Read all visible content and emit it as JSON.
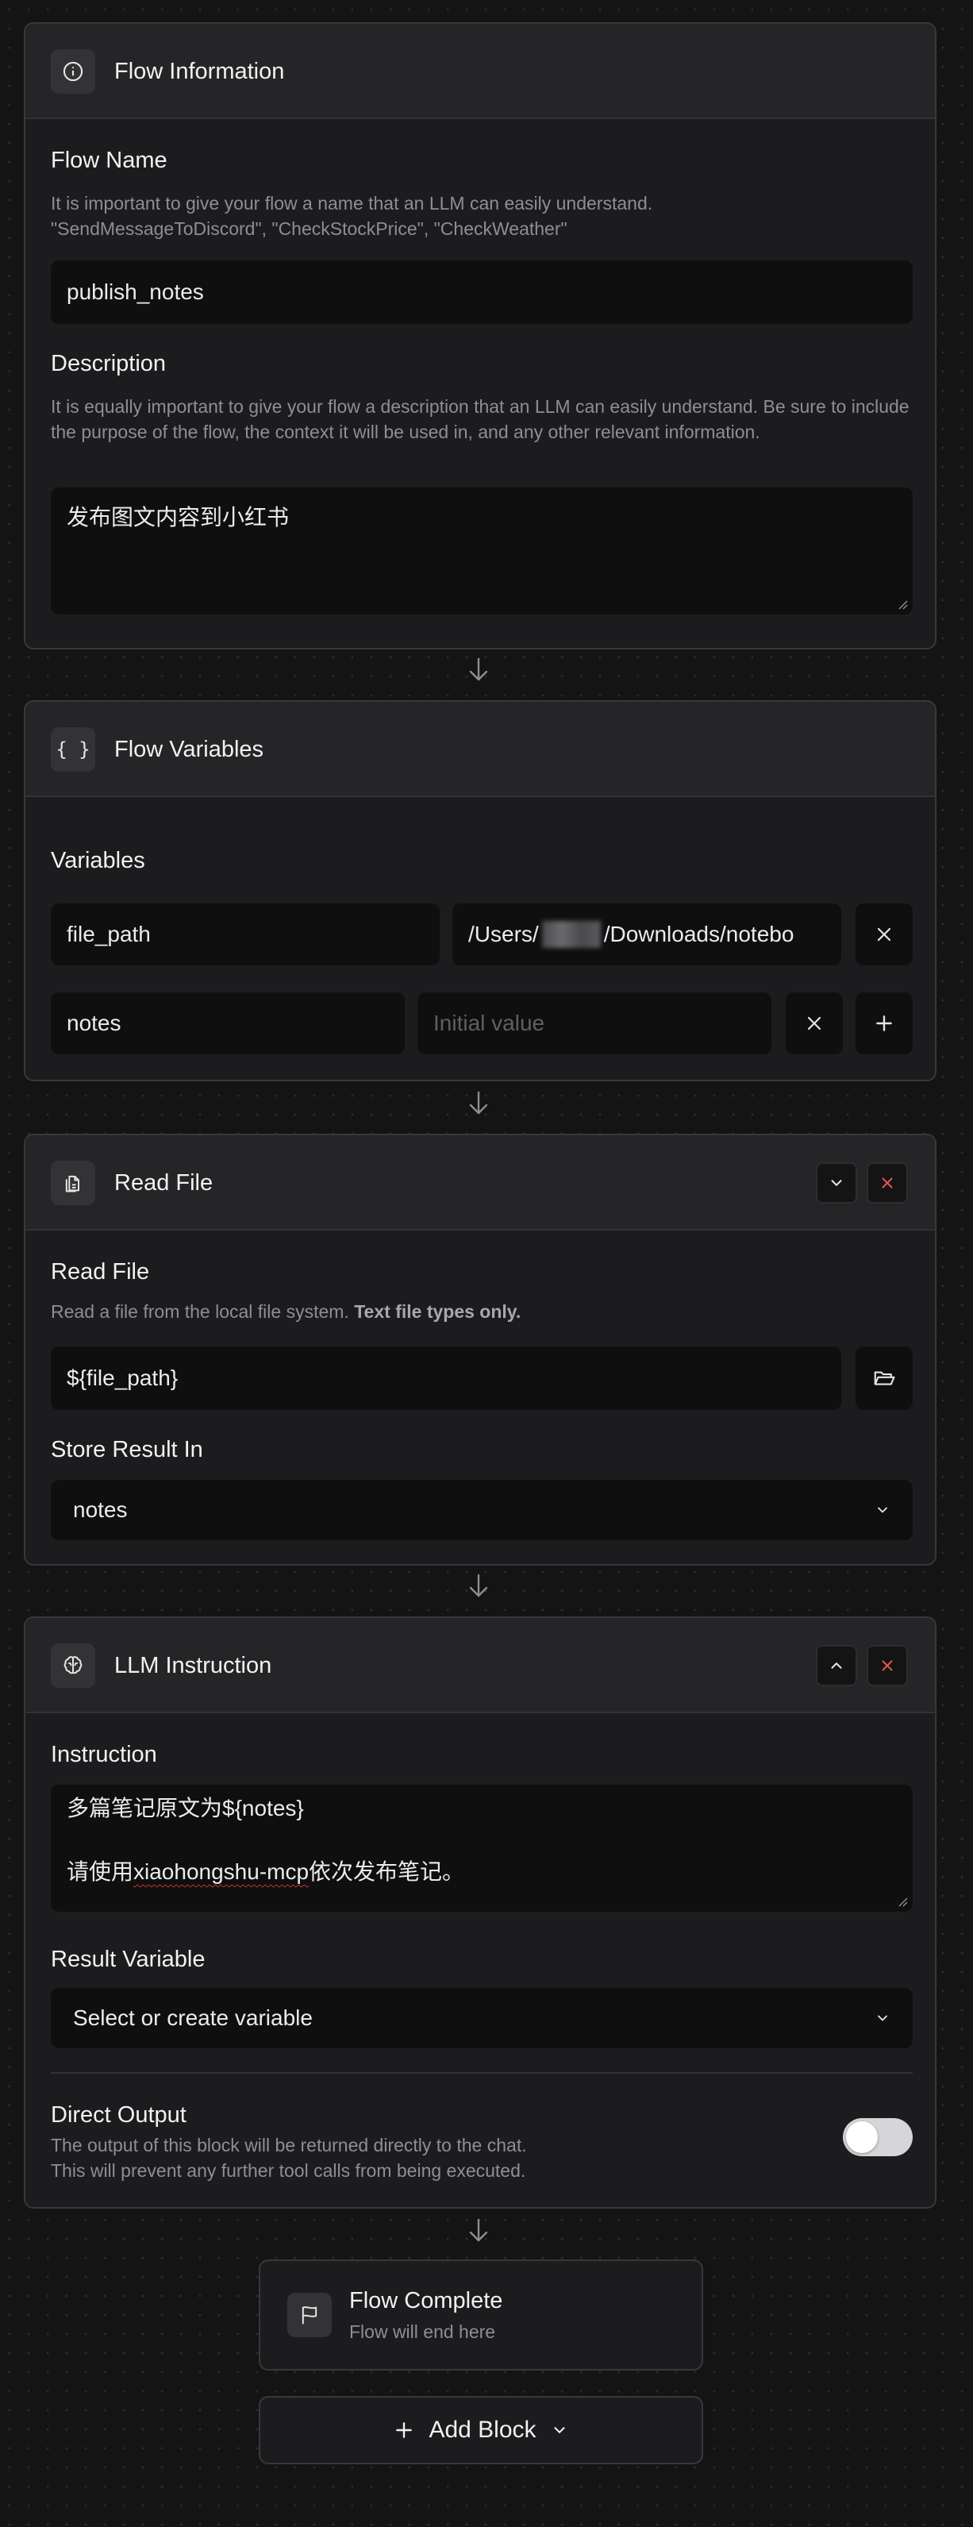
{
  "flow_info": {
    "header_title": "Flow Information",
    "name_label": "Flow Name",
    "name_help_1": "It is important to give your flow a name that an LLM can easily understand.",
    "name_help_2": "\"SendMessageToDiscord\", \"CheckStockPrice\", \"CheckWeather\"",
    "name_value": "publish_notes",
    "desc_label": "Description",
    "desc_help": "It is equally important to give your flow a description that an LLM can easily understand. Be sure to include the purpose of the flow, the context it will be used in, and any other relevant information.",
    "desc_value": "发布图文内容到小红书"
  },
  "flow_vars": {
    "header_title": "Flow Variables",
    "header_icon_text": "{ }",
    "section_label": "Variables",
    "rows": [
      {
        "name": "file_path",
        "value_prefix": "/Users/",
        "value_suffix": "/Downloads/notebo"
      },
      {
        "name": "notes",
        "value_placeholder": "Initial value"
      }
    ]
  },
  "read_file": {
    "header_title": "Read File",
    "section_label": "Read File",
    "help_text": "Read a file from the local file system.",
    "help_bold": "Text file types only.",
    "path_value": "${file_path}",
    "store_label": "Store Result In",
    "store_value": "notes"
  },
  "llm": {
    "header_title": "LLM Instruction",
    "instruction_label": "Instruction",
    "instruction_line1": "多篇笔记原文为${notes}",
    "instruction_line2_pre": "请使用",
    "instruction_line2_mark": "xiaohongshu-mcp",
    "instruction_line2_post": "依次发布笔记。",
    "result_label": "Result Variable",
    "result_value": "Select or create variable",
    "direct_label": "Direct Output",
    "direct_help_1": "The output of this block will be returned directly to the chat.",
    "direct_help_2": "This will prevent any further tool calls from being executed.",
    "direct_output_on": false
  },
  "complete": {
    "title": "Flow Complete",
    "subtitle": "Flow will end here"
  },
  "add_block": {
    "label": "Add Block"
  }
}
